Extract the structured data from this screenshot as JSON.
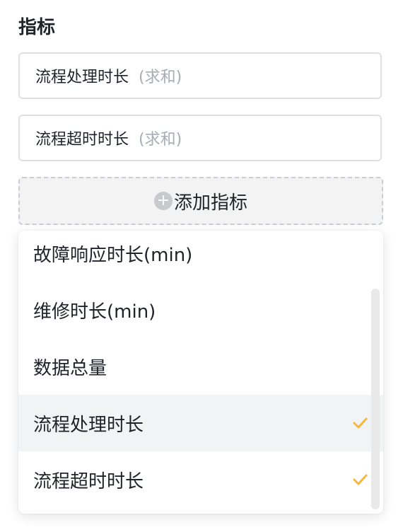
{
  "section": {
    "title": "指标"
  },
  "selected_metrics": [
    {
      "name": "流程处理时长",
      "aggregation": "(求和)"
    },
    {
      "name": "流程超时时长",
      "aggregation": "(求和)"
    }
  ],
  "add_button": {
    "label": "添加指标",
    "icon": "+"
  },
  "dropdown": {
    "options": [
      {
        "label": "故障响应时长(min)",
        "checked": false
      },
      {
        "label": "维修时长(min)",
        "checked": false
      },
      {
        "label": "数据总量",
        "checked": false
      },
      {
        "label": "流程处理时长",
        "checked": true
      },
      {
        "label": "流程超时时长",
        "checked": true
      }
    ]
  },
  "colors": {
    "check": "#f5b73d",
    "hover_bg": "#f2f3f5",
    "text": "#1f2329",
    "muted": "#a8adb4"
  }
}
